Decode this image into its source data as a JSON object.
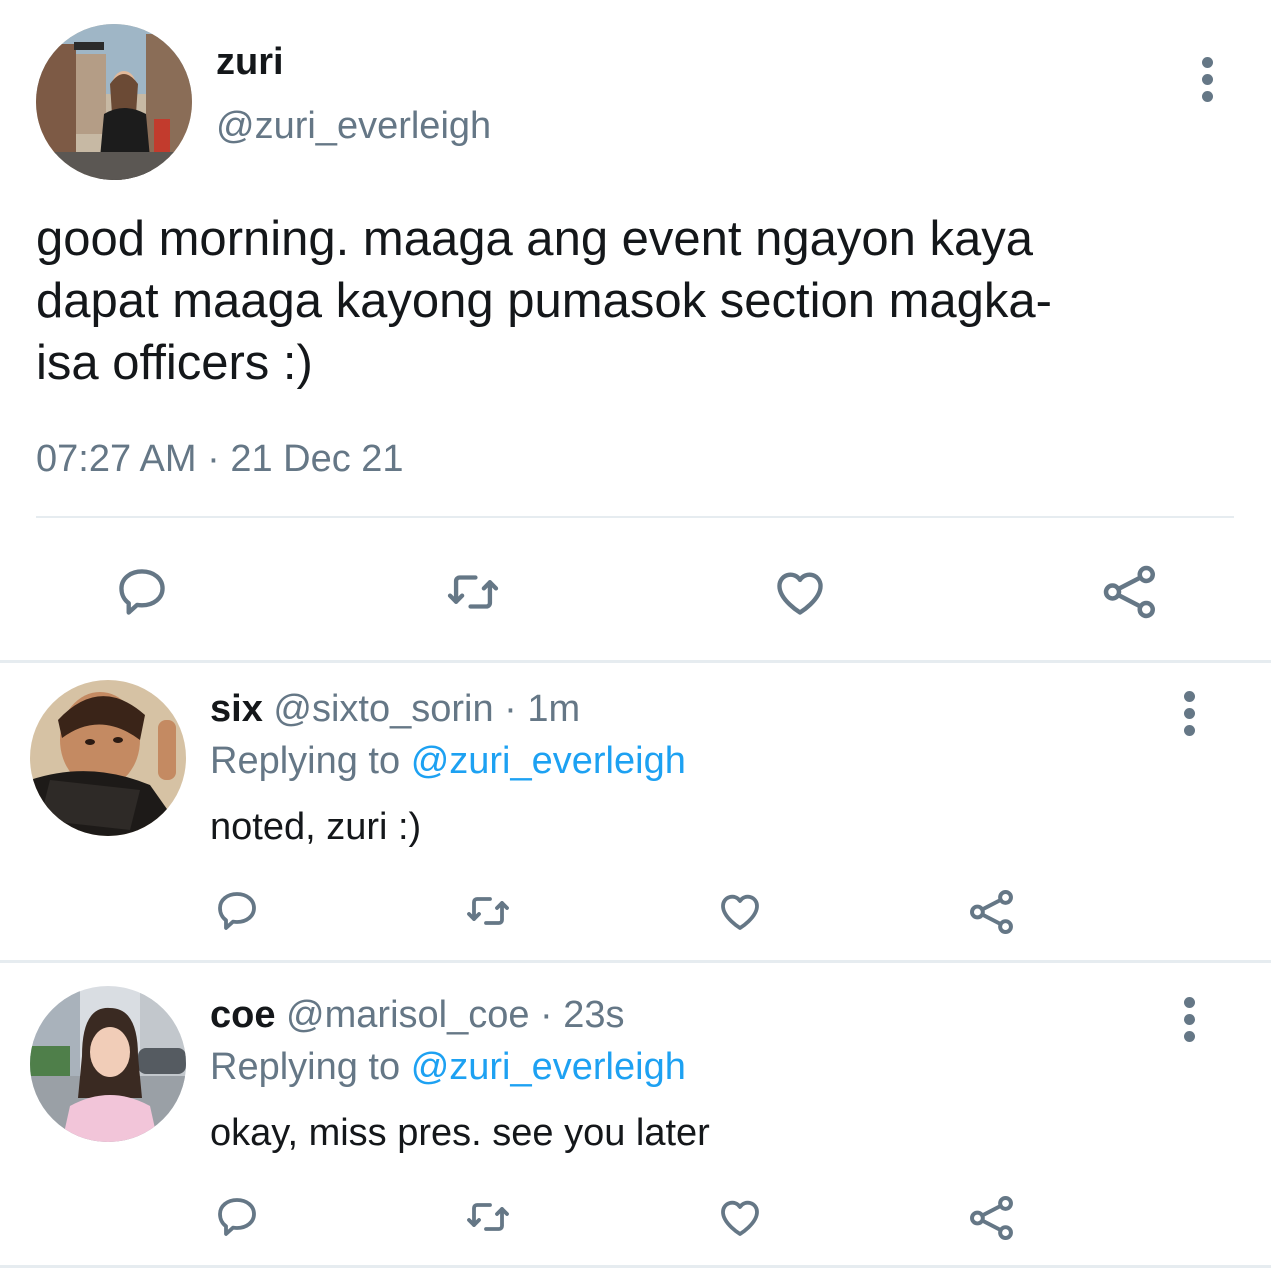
{
  "main_tweet": {
    "display_name": "zuri",
    "handle": "@zuri_everleigh",
    "text_lines": [
      "good morning. maaga ang event ngayon kaya",
      "dapat maaga kayong pumasok section magka-",
      "isa officers :)"
    ],
    "timestamp": "07:27 AM · 21 Dec 21",
    "actions": [
      "reply-icon",
      "retweet-icon",
      "like-icon",
      "share-icon"
    ]
  },
  "replies": [
    {
      "display_name": "six",
      "handle": "@sixto_sorin",
      "time": "· 1m",
      "replying_prefix": "Replying to",
      "replying_to": "@zuri_everleigh",
      "text": "noted, zuri :)"
    },
    {
      "display_name": "coe",
      "handle": "@marisol_coe",
      "time": "· 23s",
      "replying_prefix": "Replying to",
      "replying_to": "@zuri_everleigh",
      "text": "okay, miss pres. see you later"
    }
  ],
  "colors": {
    "text": "#14171a",
    "muted": "#657786",
    "link": "#1da1f2",
    "divider": "#e6ecf0"
  }
}
